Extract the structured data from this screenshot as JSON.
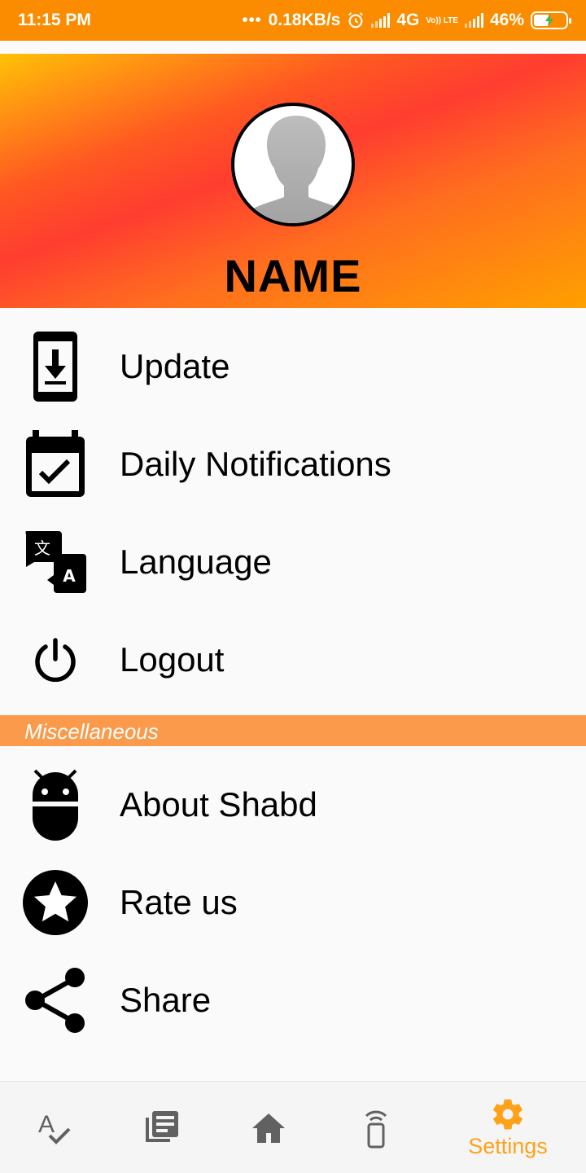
{
  "status_bar": {
    "time": "11:15 PM",
    "dots": "•••",
    "speed": "0.18KB/s",
    "network": "4G",
    "volte": "Vo)) LTE",
    "battery": "46%"
  },
  "profile": {
    "name": "NAME"
  },
  "menu": {
    "items": [
      {
        "label": "Update",
        "icon": "phone-download-icon"
      },
      {
        "label": "Daily Notifications",
        "icon": "calendar-check-icon"
      },
      {
        "label": "Language",
        "icon": "translate-icon"
      },
      {
        "label": "Logout",
        "icon": "power-icon"
      }
    ],
    "section_title": "Miscellaneous",
    "misc_items": [
      {
        "label": "About Shabd",
        "icon": "android-icon"
      },
      {
        "label": "Rate us",
        "icon": "star-icon"
      },
      {
        "label": "Share",
        "icon": "share-icon"
      }
    ]
  },
  "bottom_nav": {
    "items": [
      {
        "icon": "spellcheck-icon",
        "label": ""
      },
      {
        "icon": "library-icon",
        "label": ""
      },
      {
        "icon": "home-icon",
        "label": ""
      },
      {
        "icon": "phone-broadcast-icon",
        "label": ""
      },
      {
        "icon": "settings-gear-icon",
        "label": "Settings",
        "active": true
      }
    ],
    "active_color": "#ffa21a",
    "inactive_color": "#616161"
  },
  "colors": {
    "status_bar": "#fb8c00",
    "section_header": "#fb9a4a"
  }
}
